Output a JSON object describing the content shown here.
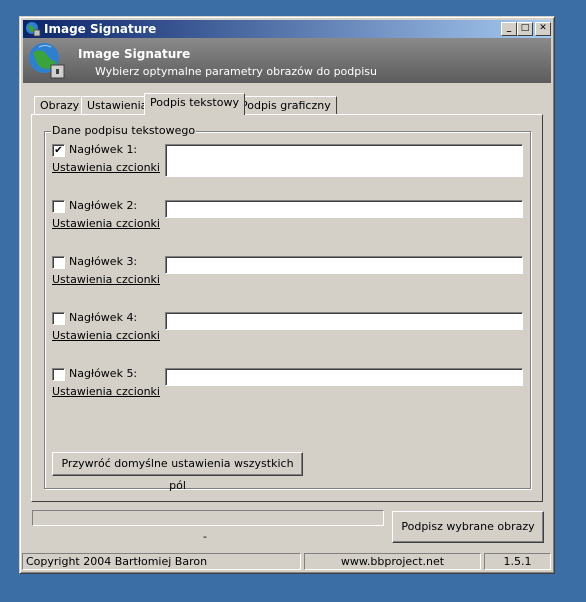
{
  "window": {
    "title": "Image Signature"
  },
  "titlebar_buttons": {
    "minimize": "_",
    "maximize": "□",
    "close": "✕"
  },
  "header": {
    "title": "Image Signature",
    "subtitle": "Wybierz optymalne parametry obrazów do podpisu"
  },
  "tabs": [
    {
      "label": "Obrazy",
      "active": false
    },
    {
      "label": "Ustawienia",
      "active": false
    },
    {
      "label": "Podpis tekstowy",
      "active": true
    },
    {
      "label": "Podpis graficzny",
      "active": false
    }
  ],
  "group": {
    "legend": "Dane podpisu tekstowego"
  },
  "headers": [
    {
      "label": "Nagłówek 1:",
      "checked": true,
      "font_link": "Ustawienia czcionki",
      "value": ""
    },
    {
      "label": "Nagłówek 2:",
      "checked": false,
      "font_link": "Ustawienia czcionki",
      "value": ""
    },
    {
      "label": "Nagłówek 3:",
      "checked": false,
      "font_link": "Ustawienia czcionki",
      "value": ""
    },
    {
      "label": "Nagłówek 4:",
      "checked": false,
      "font_link": "Ustawienia czcionki",
      "value": ""
    },
    {
      "label": "Nagłówek 5:",
      "checked": false,
      "font_link": "Ustawienia czcionki",
      "value": ""
    }
  ],
  "reset_button": "Przywróć domyślne ustawienia wszystkich pól",
  "progress": {
    "value": 0,
    "text": "-"
  },
  "sign_button": "Podpisz wybrane obrazy",
  "statusbar": {
    "copyright": "Copyright 2004 Bartłomiej Baron",
    "website": "www.bbproject.net",
    "version": "1.5.1"
  },
  "icons": {
    "app": "globe-lock-icon",
    "banner": "globe-lock-icon"
  },
  "colors": {
    "titlebar_start": "#0a246a",
    "titlebar_end": "#a6caf0",
    "face": "#d4d0c8"
  }
}
